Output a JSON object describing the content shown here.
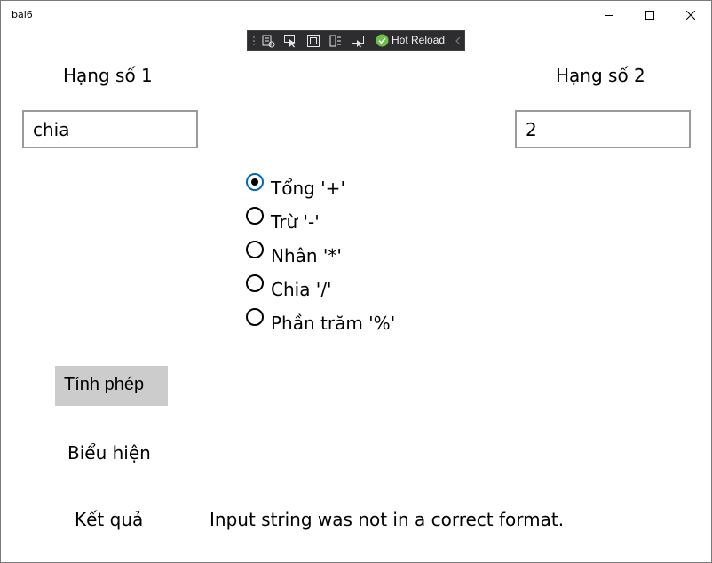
{
  "window": {
    "title": "bai6",
    "controls": {
      "minimize": "minimize-icon",
      "maximize": "maximize-icon",
      "close": "close-icon"
    }
  },
  "hot_reload_toolbar": {
    "label": "Hot Reload",
    "icons": [
      "live-visual-tree-icon",
      "select-element-icon",
      "layout-adorners-icon",
      "track-focus-icon",
      "display-element-icon",
      "hot-reload-check-icon",
      "collapse-chevron-icon"
    ],
    "colors": {
      "background": "#2d2d30",
      "check": "#6cc04a"
    }
  },
  "form": {
    "operand1": {
      "label": "Hạng số 1",
      "value": "chia"
    },
    "operand2": {
      "label": "Hạng số 2",
      "value": "2"
    },
    "operations": [
      {
        "label": "Tổng '+'",
        "checked": true
      },
      {
        "label": "Trừ '-'",
        "checked": false
      },
      {
        "label": "Nhân '*'",
        "checked": false
      },
      {
        "label": "Chia '/'",
        "checked": false
      },
      {
        "label": "Phần trăm '%'",
        "checked": false
      }
    ],
    "compute_button": "Tính phép",
    "expression_label": "Biểu hiện",
    "expression_value": "",
    "result_label": "Kết quả",
    "result_value": "Input string was not in a correct format."
  },
  "colors": {
    "radio_accent": "#0067c0",
    "button_bg": "#cccccc",
    "textbox_border": "#9a9a9a"
  }
}
